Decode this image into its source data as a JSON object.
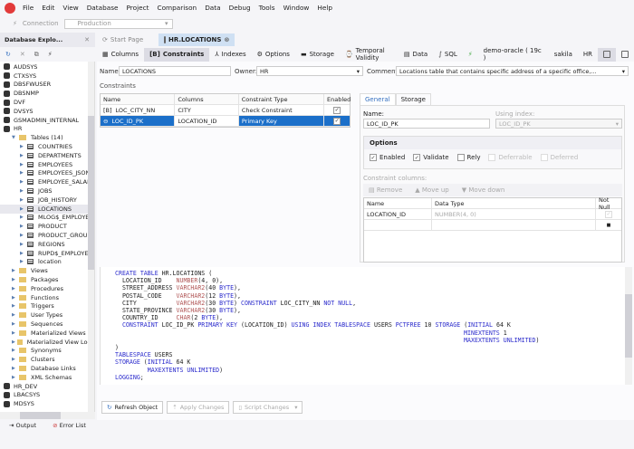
{
  "menu": [
    "File",
    "Edit",
    "View",
    "Database",
    "Project",
    "Comparison",
    "Data",
    "Debug",
    "Tools",
    "Window",
    "Help"
  ],
  "connection": {
    "label": "Connection",
    "value": "Production"
  },
  "explorer": {
    "title": "Database Explo...",
    "tree": [
      {
        "label": "AUDSYS",
        "type": "db"
      },
      {
        "label": "CTXSYS",
        "type": "db"
      },
      {
        "label": "DBSFWUSER",
        "type": "db"
      },
      {
        "label": "DBSNMP",
        "type": "db"
      },
      {
        "label": "DVF",
        "type": "db"
      },
      {
        "label": "DVSYS",
        "type": "db"
      },
      {
        "label": "GSMADMIN_INTERNAL",
        "type": "db"
      },
      {
        "label": "HR",
        "type": "db"
      },
      {
        "label": "Tables (14)",
        "type": "folder",
        "level": 1,
        "open": true
      },
      {
        "label": "COUNTRIES",
        "type": "table",
        "level": 2
      },
      {
        "label": "DEPARTMENTS",
        "type": "table",
        "level": 2
      },
      {
        "label": "EMPLOYEES",
        "type": "table",
        "level": 2
      },
      {
        "label": "EMPLOYEES_JSON",
        "type": "table",
        "level": 2
      },
      {
        "label": "EMPLOYEE_SALARI",
        "type": "table",
        "level": 2
      },
      {
        "label": "JOBS",
        "type": "table",
        "level": 2
      },
      {
        "label": "JOB_HISTORY",
        "type": "table",
        "level": 2
      },
      {
        "label": "LOCATIONS",
        "type": "table",
        "level": 2,
        "selected": true
      },
      {
        "label": "MLOG$_EMPLOYEE",
        "type": "table",
        "level": 2
      },
      {
        "label": "PRODUCT",
        "type": "table",
        "level": 2
      },
      {
        "label": "PRODUCT_GROUP",
        "type": "table",
        "level": 2
      },
      {
        "label": "REGIONS",
        "type": "table",
        "level": 2
      },
      {
        "label": "RUPD$_EMPLOYEE",
        "type": "table",
        "level": 2
      },
      {
        "label": "location",
        "type": "table",
        "level": 2
      },
      {
        "label": "Views",
        "type": "folder",
        "level": 1
      },
      {
        "label": "Packages",
        "type": "folder",
        "level": 1
      },
      {
        "label": "Procedures",
        "type": "folder",
        "level": 1
      },
      {
        "label": "Functions",
        "type": "folder",
        "level": 1
      },
      {
        "label": "Triggers",
        "type": "folder",
        "level": 1
      },
      {
        "label": "User Types",
        "type": "folder",
        "level": 1
      },
      {
        "label": "Sequences",
        "type": "folder",
        "level": 1
      },
      {
        "label": "Materialized Views",
        "type": "folder",
        "level": 1
      },
      {
        "label": "Materialized View Logs",
        "type": "folder",
        "level": 1
      },
      {
        "label": "Synonyms",
        "type": "folder",
        "level": 1
      },
      {
        "label": "Clusters",
        "type": "folder",
        "level": 1
      },
      {
        "label": "Database Links",
        "type": "folder",
        "level": 1
      },
      {
        "label": "XML Schemas",
        "type": "folder",
        "level": 1
      },
      {
        "label": "HR_DEV",
        "type": "db"
      },
      {
        "label": "LBACSYS",
        "type": "db"
      },
      {
        "label": "MDSYS",
        "type": "db"
      }
    ]
  },
  "doc_tabs": [
    {
      "label": "Start Page"
    },
    {
      "label": "HR.LOCATIONS",
      "active": true
    }
  ],
  "editor_tabs": [
    "Columns",
    "Constraints",
    "Indexes",
    "Options",
    "Storage",
    "Temporal Validity",
    "Data",
    "SQL"
  ],
  "conn_info": {
    "server": "demo-oracle ( 19c )",
    "db": "sakila",
    "schema": "HR"
  },
  "form": {
    "name_label": "Name:",
    "name": "LOCATIONS",
    "owner_label": "Owner:",
    "owner": "HR",
    "comment_label": "Comment:",
    "comment": "Locations table that contains specific address of a specific office,..."
  },
  "constraints": {
    "label": "Constraints",
    "headers": [
      "Name",
      "Columns",
      "Constraint Type",
      "Enabled"
    ],
    "rows": [
      {
        "name": "LOC_CITY_NN",
        "columns": "CITY",
        "type": "Check Constraint",
        "enabled": true
      },
      {
        "name": "LOC_ID_PK",
        "columns": "LOCATION_ID",
        "type": "Primary Key",
        "enabled": true,
        "selected": true
      }
    ]
  },
  "detail": {
    "tabs": [
      "General",
      "Storage"
    ],
    "name_label": "Name:",
    "name": "LOC_ID_PK",
    "index_label": "Using index:",
    "index": "LOC_ID_PK",
    "options_title": "Options",
    "options": [
      {
        "label": "Enabled",
        "checked": true
      },
      {
        "label": "Validate",
        "checked": true
      },
      {
        "label": "Rely",
        "checked": false
      },
      {
        "label": "Deferrable",
        "checked": false,
        "disabled": true
      },
      {
        "label": "Deferred",
        "checked": false,
        "disabled": true
      }
    ],
    "cc_label": "Constraint columns:",
    "cc_actions": [
      "Remove",
      "Move up",
      "Move down"
    ],
    "cc_headers": [
      "Name",
      "Data Type",
      "Not Null"
    ],
    "cc_rows": [
      {
        "name": "LOCATION_ID",
        "type": "NUMBER(4, 0)"
      }
    ]
  },
  "sql": [
    "CREATE TABLE HR.LOCATIONS (",
    "  LOCATION_ID    NUMBER(4, 0),",
    "  STREET_ADDRESS VARCHAR2(40 BYTE),",
    "  POSTAL_CODE    VARCHAR2(12 BYTE),",
    "  CITY           VARCHAR2(30 BYTE) CONSTRAINT LOC_CITY_NN NOT NULL,",
    "  STATE_PROVINCE VARCHAR2(30 BYTE),",
    "  COUNTRY_ID     CHAR(2 BYTE),",
    "  CONSTRAINT LOC_ID_PK PRIMARY KEY (LOCATION_ID) USING INDEX TABLESPACE USERS PCTFREE 10 STORAGE (INITIAL 64 K",
    "                                                                                                 MINEXTENTS 1",
    "                                                                                                 MAXEXTENTS UNLIMITED)",
    ")",
    "TABLESPACE USERS",
    "STORAGE (INITIAL 64 K",
    "         MAXEXTENTS UNLIMITED)",
    "LOGGING;"
  ],
  "actions": {
    "refresh": "Refresh Object",
    "apply": "Apply Changes",
    "script": "Script Changes"
  },
  "bottom_tabs": [
    "Output",
    "Error List"
  ],
  "colors": {
    "accent": "#1b6fc9",
    "keyword": "#2b2bcc",
    "type": "#b05555"
  }
}
